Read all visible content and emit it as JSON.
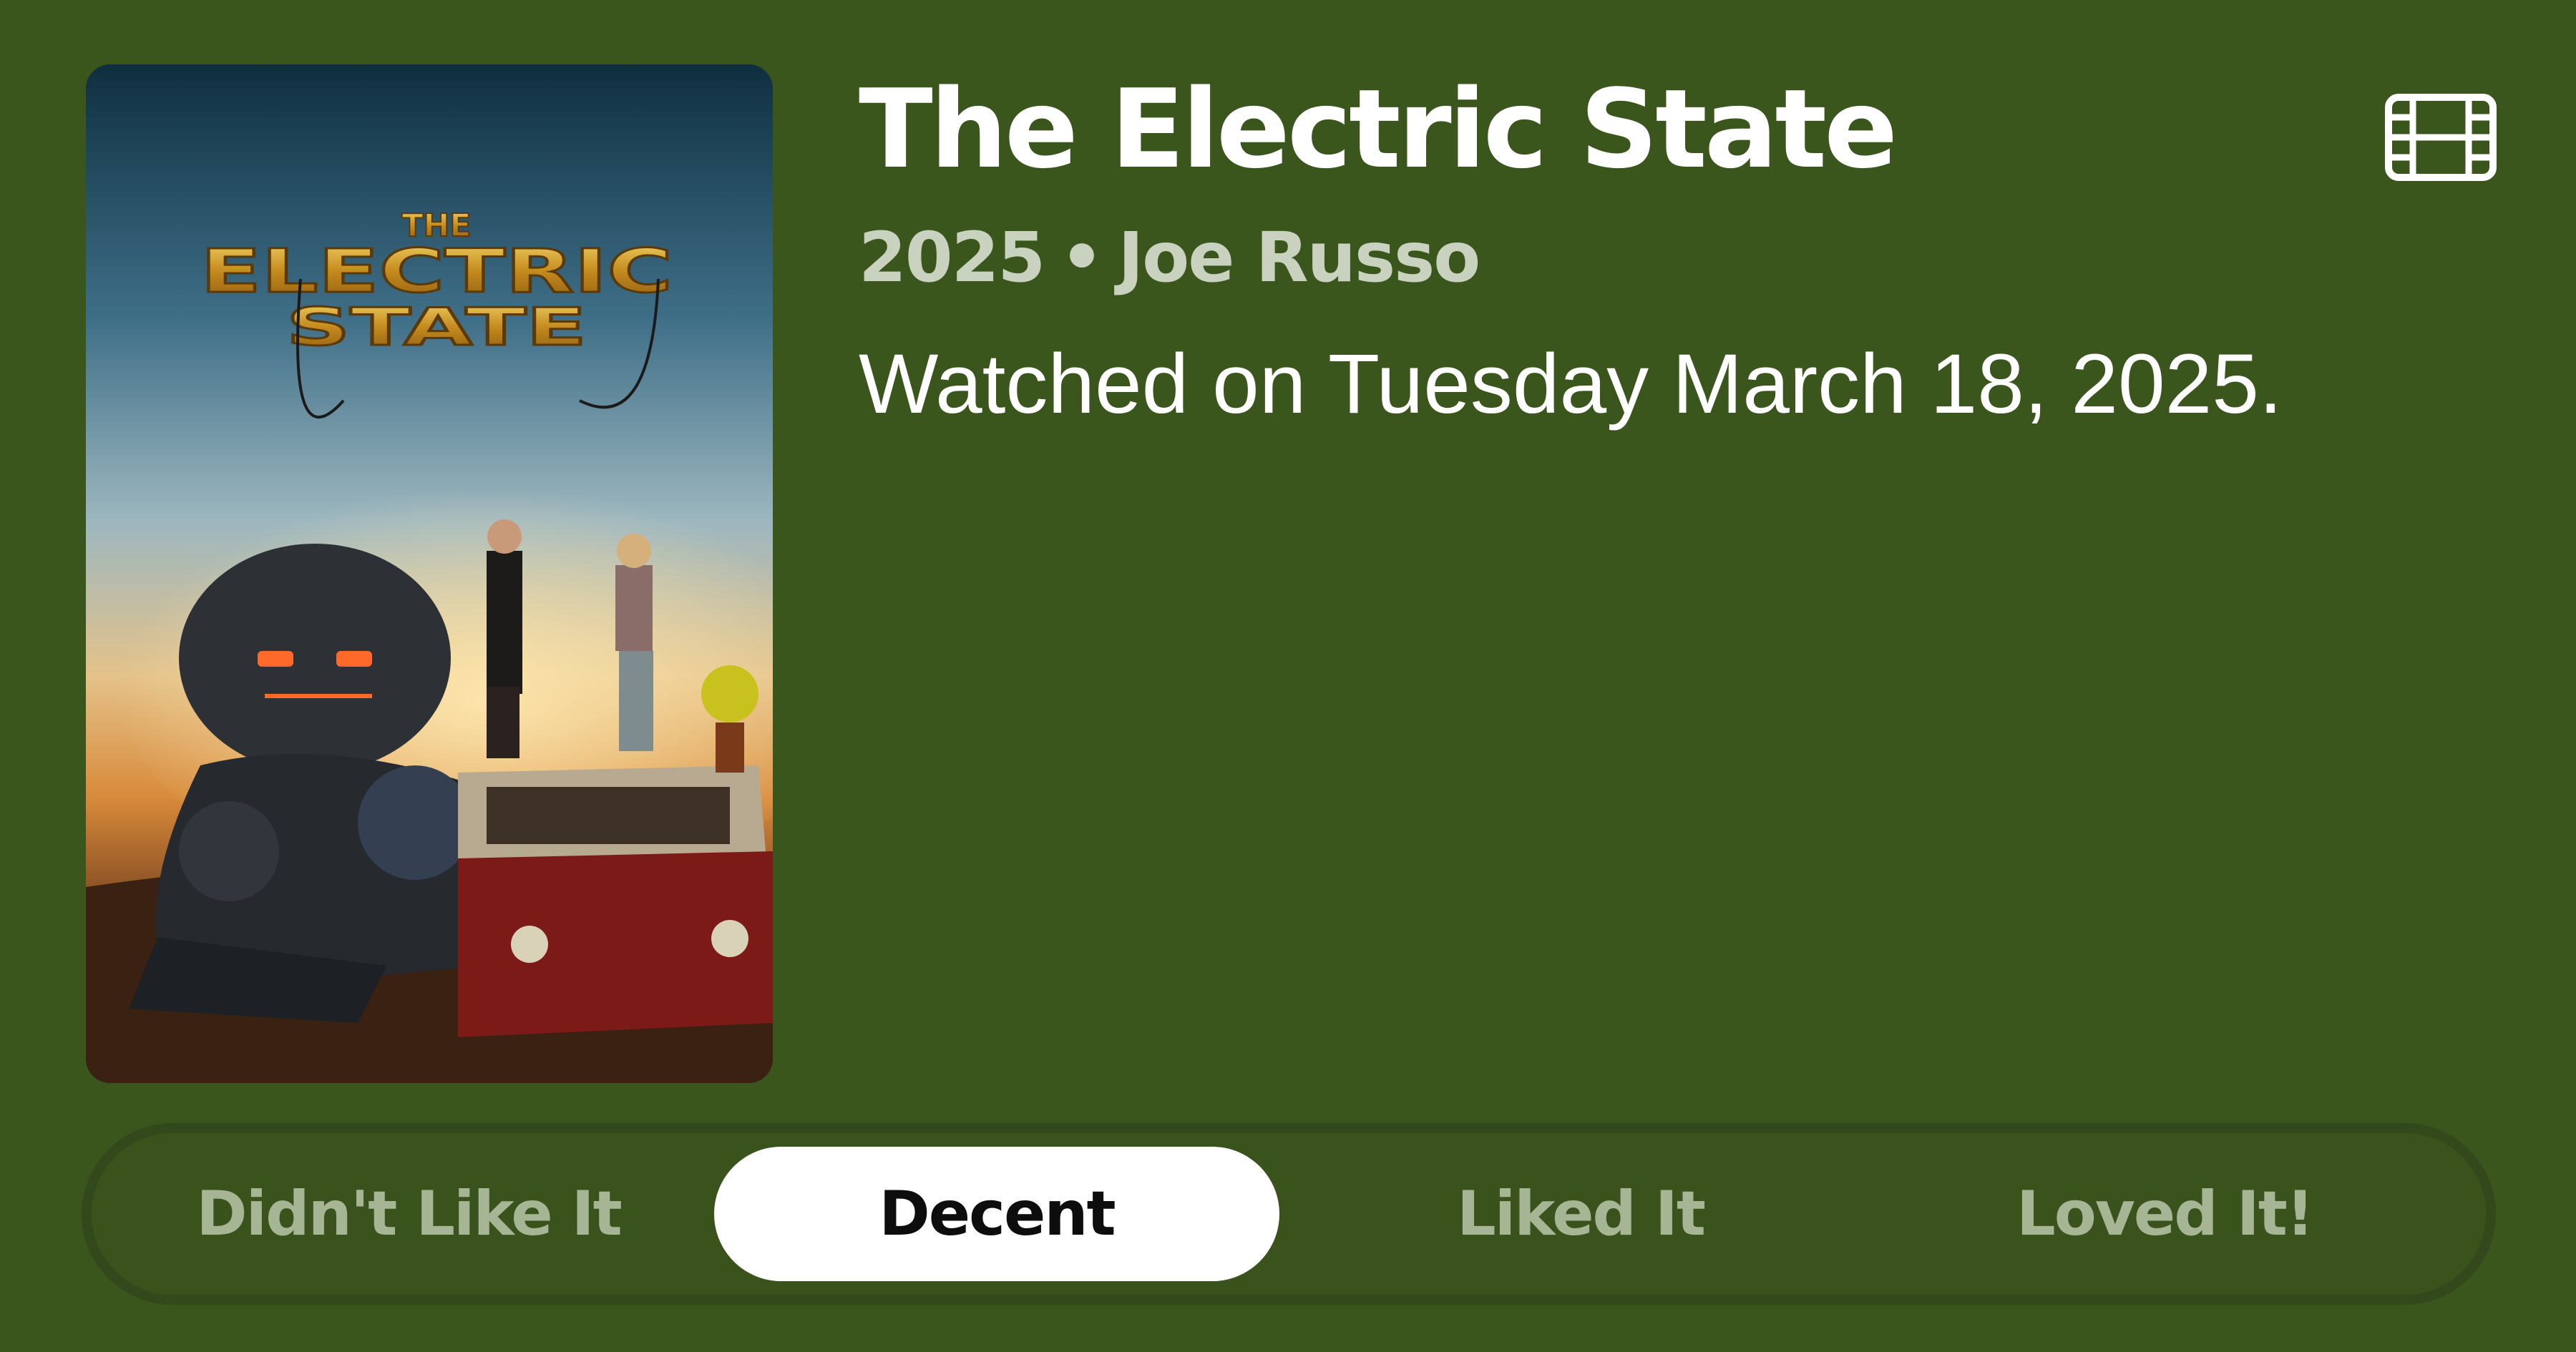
{
  "movie": {
    "title": "The Electric State",
    "year": "2025",
    "separator": "•",
    "director": "Joe Russo",
    "watched_text": "Watched on Tuesday March 18, 2025."
  },
  "poster": {
    "logo_line1": "THE",
    "logo_line2": "ELECTRIC",
    "logo_line3": "STATE"
  },
  "media_icon": "film-icon",
  "rating": {
    "options": [
      "Didn't Like It",
      "Decent",
      "Liked It",
      "Loved It!"
    ],
    "selected": "Decent"
  },
  "colors": {
    "background": "#3b561d",
    "text_primary": "#ffffff",
    "text_secondary": "#c9d1bf",
    "option_inactive": "#a6b593",
    "selected_bg": "#ffffff"
  }
}
